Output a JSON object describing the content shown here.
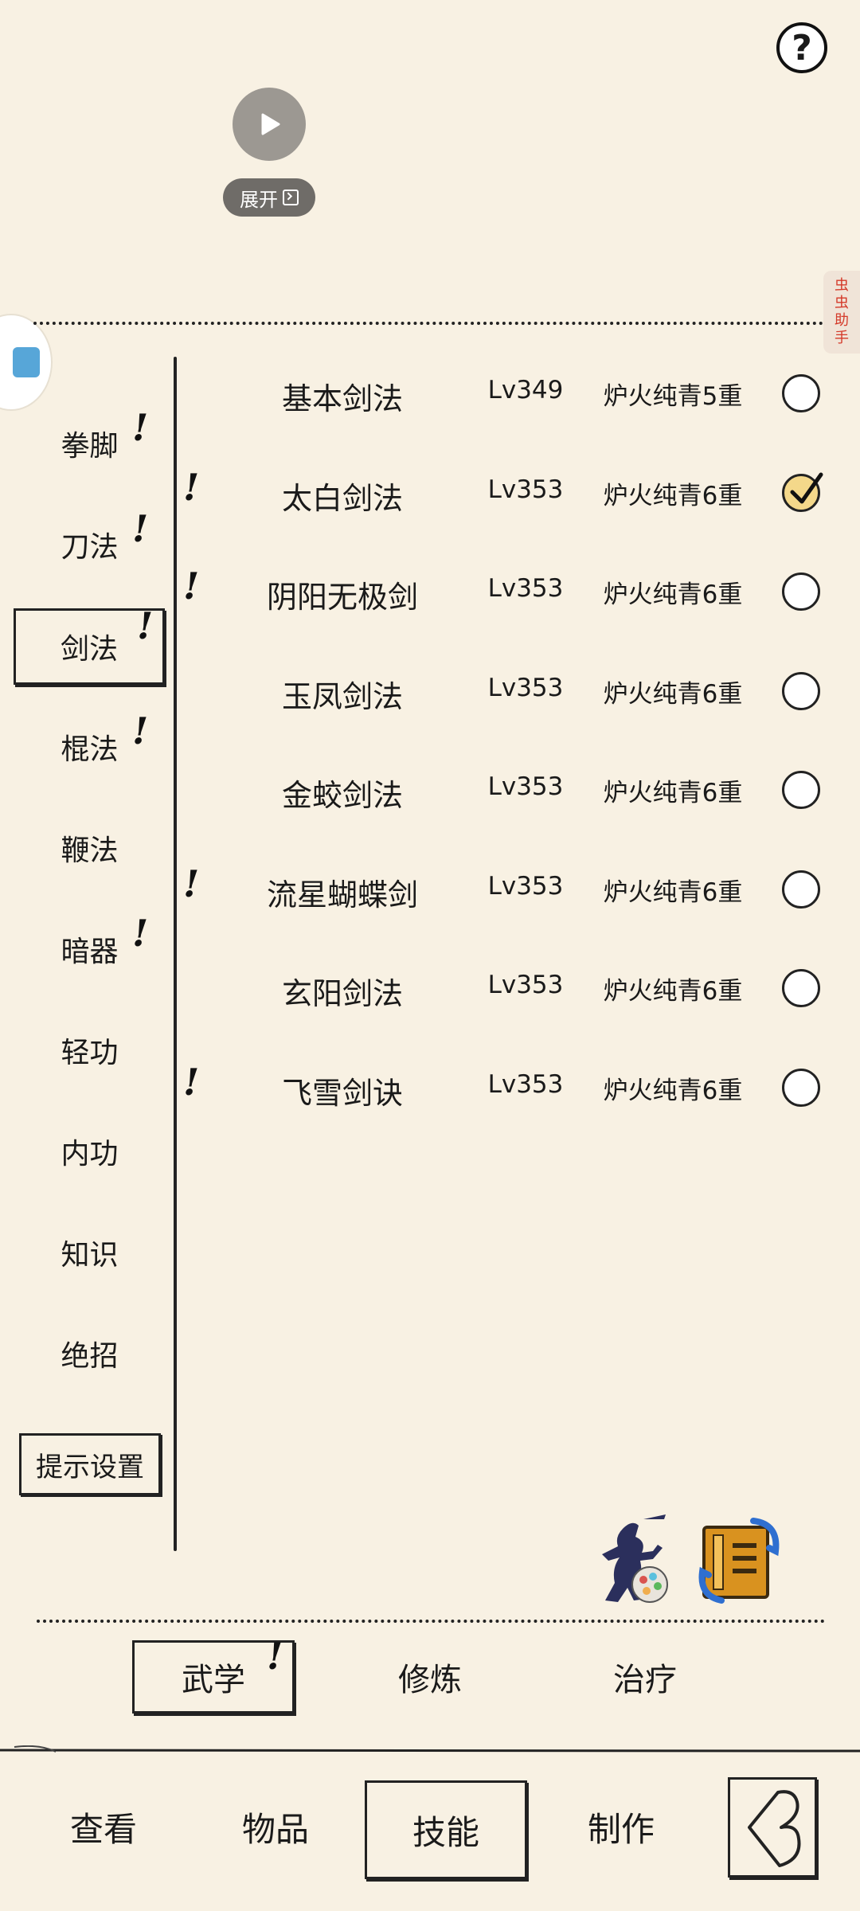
{
  "overlay": {
    "expand_label": "展开",
    "assistant_label": [
      "虫",
      "虫",
      "助",
      "手"
    ]
  },
  "help": {
    "label": "?"
  },
  "categories": [
    {
      "label": "拳脚",
      "alert": true
    },
    {
      "label": "刀法",
      "alert": true
    },
    {
      "label": "剑法",
      "alert": true,
      "selected": true
    },
    {
      "label": "棍法",
      "alert": true
    },
    {
      "label": "鞭法",
      "alert": false
    },
    {
      "label": "暗器",
      "alert": true
    },
    {
      "label": "轻功",
      "alert": false
    },
    {
      "label": "内功",
      "alert": false
    },
    {
      "label": "知识",
      "alert": false
    },
    {
      "label": "绝招",
      "alert": false
    }
  ],
  "hint_settings_label": "提示设置",
  "alert_mark": "!",
  "skills": [
    {
      "name": "基本剑法",
      "level": "Lv349",
      "realm": "炉火纯青5重",
      "checked": false,
      "alert": false
    },
    {
      "name": "太白剑法",
      "level": "Lv353",
      "realm": "炉火纯青6重",
      "checked": true,
      "alert": true
    },
    {
      "name": "阴阳无极剑",
      "level": "Lv353",
      "realm": "炉火纯青6重",
      "checked": false,
      "alert": true
    },
    {
      "name": "玉凤剑法",
      "level": "Lv353",
      "realm": "炉火纯青6重",
      "checked": false,
      "alert": false
    },
    {
      "name": "金蛟剑法",
      "level": "Lv353",
      "realm": "炉火纯青6重",
      "checked": false,
      "alert": false
    },
    {
      "name": "流星蝴蝶剑",
      "level": "Lv353",
      "realm": "炉火纯青6重",
      "checked": false,
      "alert": true
    },
    {
      "name": "玄阳剑法",
      "level": "Lv353",
      "realm": "炉火纯青6重",
      "checked": false,
      "alert": false
    },
    {
      "name": "飞雪剑诀",
      "level": "Lv353",
      "realm": "炉火纯青6重",
      "checked": false,
      "alert": true
    }
  ],
  "subtabs": [
    {
      "label": "武学",
      "selected": true,
      "alert": true
    },
    {
      "label": "修炼",
      "selected": false,
      "alert": false
    },
    {
      "label": "治疗",
      "selected": false,
      "alert": false
    }
  ],
  "nav": [
    {
      "label": "查看",
      "selected": false
    },
    {
      "label": "物品",
      "selected": false
    },
    {
      "label": "技能",
      "selected": true
    },
    {
      "label": "制作",
      "selected": false
    }
  ],
  "colors": {
    "background": "#f8f1e3",
    "ink": "#1a1a1a",
    "assistant_text": "#d43a2a",
    "checked_fill": "#f4d88a"
  }
}
